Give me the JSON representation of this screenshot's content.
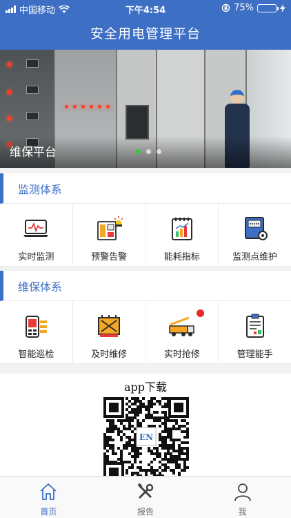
{
  "status_bar": {
    "carrier": "中国移动",
    "time": "下午4:54",
    "battery": "75%",
    "battery_level": 0.75
  },
  "header": {
    "title": "安全用电管理平台"
  },
  "banner": {
    "caption": "维保平台",
    "slide_count": 3,
    "active_slide": 0
  },
  "monitor_section": {
    "title": "监测体系",
    "items": [
      {
        "label": "实时监测",
        "icon": "laptop-chart-icon"
      },
      {
        "label": "预警告警",
        "icon": "alarm-panel-icon"
      },
      {
        "label": "能耗指标",
        "icon": "energy-chart-icon"
      },
      {
        "label": "监测点维护",
        "icon": "meter-gear-icon"
      }
    ]
  },
  "maint_section": {
    "title": "维保体系",
    "items": [
      {
        "label": "智能巡检",
        "icon": "inspection-device-icon"
      },
      {
        "label": "及时维修",
        "icon": "transformer-icon"
      },
      {
        "label": "实时抢修",
        "icon": "crane-truck-icon"
      },
      {
        "label": "管理能手",
        "icon": "clipboard-report-icon"
      }
    ]
  },
  "download": {
    "title": "app下载"
  },
  "tabbar": {
    "tabs": [
      {
        "label": "首页",
        "icon": "home-icon",
        "active": true
      },
      {
        "label": "报告",
        "icon": "tools-icon",
        "active": false
      },
      {
        "label": "我",
        "icon": "user-icon",
        "active": false
      }
    ]
  },
  "colors": {
    "brand_blue": "#3d6fc4",
    "active_dot": "#3cc23c",
    "badge_red": "#e8282a"
  }
}
